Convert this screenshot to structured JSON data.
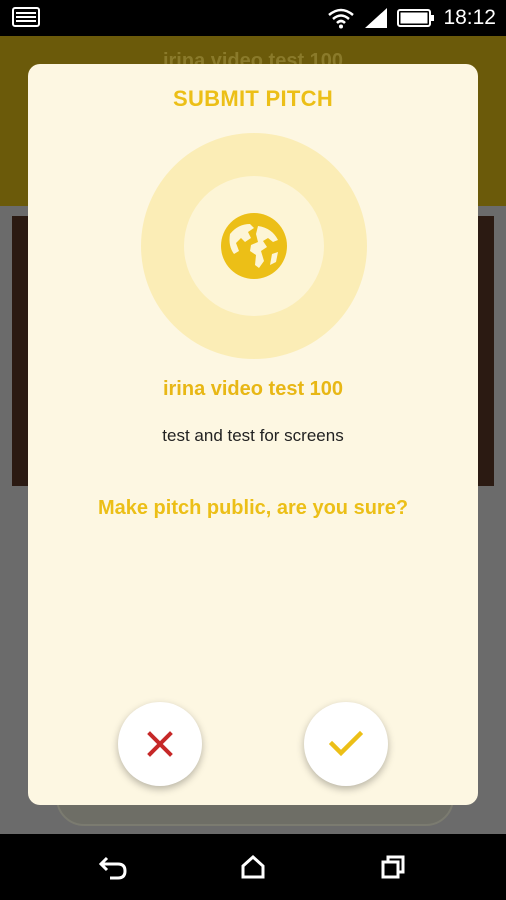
{
  "status_bar": {
    "time": "18:12",
    "icons": [
      "notification-icon",
      "wifi-icon",
      "signal-icon",
      "battery-icon"
    ]
  },
  "background_app": {
    "title": "irina video test 100"
  },
  "dialog": {
    "title": "SUBMIT PITCH",
    "icon": "globe-icon",
    "pitch_title": "irina video test 100",
    "pitch_description": "test and test for screens",
    "confirm_question": "Make pitch public, are you sure?",
    "cancel_icon": "close-icon",
    "confirm_icon": "check-icon"
  },
  "nav_bar": {
    "icons": [
      "back-icon",
      "home-icon",
      "recent-apps-icon"
    ]
  },
  "colors": {
    "accent": "#ecbf17",
    "dialog_bg": "#fdf7e2",
    "cancel": "#c62828"
  }
}
